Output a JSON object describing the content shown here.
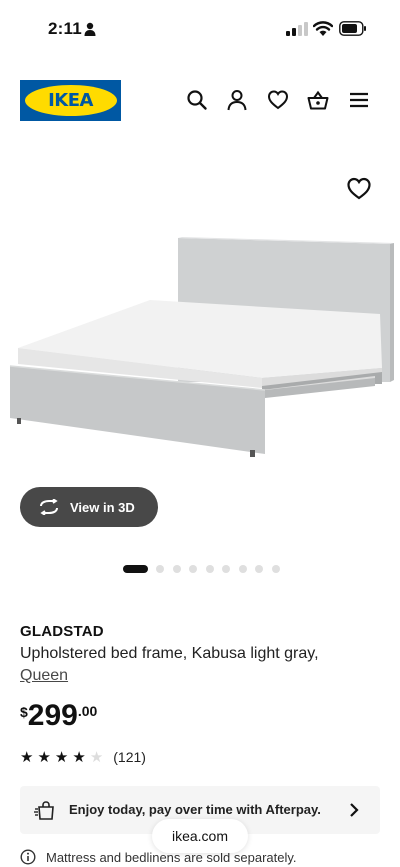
{
  "status_bar": {
    "time": "2:11",
    "icons": [
      "person-icon",
      "signal-icon",
      "wifi-icon",
      "battery-icon"
    ]
  },
  "header": {
    "logo_text": "IKEA",
    "icons": [
      "search-icon",
      "account-icon",
      "heart-icon",
      "basket-icon",
      "menu-icon"
    ]
  },
  "carousel": {
    "view3d_label": "View in 3D",
    "slide_count": 10,
    "active_slide": 1
  },
  "product": {
    "name": "GLADSTAD",
    "description": "Upholstered bed frame, Kabusa light gray,",
    "size": "Queen",
    "price": {
      "currency": "$",
      "integer": "299",
      "decimal": ".00"
    },
    "rating": {
      "stars": 4,
      "max": 5,
      "count": "(121)"
    }
  },
  "afterpay": {
    "text": "Enjoy today, pay over time with Afterpay."
  },
  "browser": {
    "url": "ikea.com"
  },
  "notice": {
    "text": "Mattress and bedlinens are sold separately."
  },
  "colors": {
    "ikea_blue": "#0058a3",
    "ikea_yellow": "#ffdb00",
    "button_dark": "#484848",
    "panel_gray": "#f5f5f5"
  }
}
